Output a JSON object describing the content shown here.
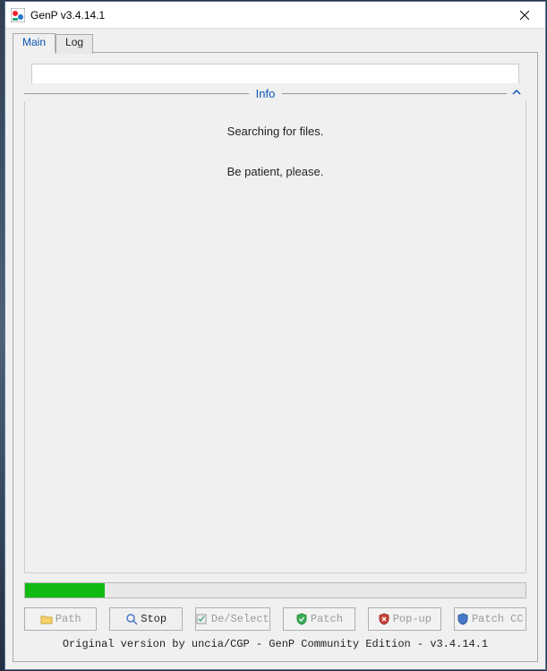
{
  "window": {
    "title": "GenP v3.4.14.1"
  },
  "tabs": {
    "main": "Main",
    "log": "Log"
  },
  "info": {
    "header": "Info",
    "line1": "Searching for files.",
    "line2": "Be patient, please."
  },
  "progress": {
    "percent": 16
  },
  "buttons": {
    "path": "Path",
    "stop": "Stop",
    "deselect": "De/Select",
    "patch": "Patch",
    "popup": "Pop-up",
    "patchcc": "Patch CC"
  },
  "footer": "Original version by uncia/CGP - GenP Community Edition - v3.4.14.1"
}
